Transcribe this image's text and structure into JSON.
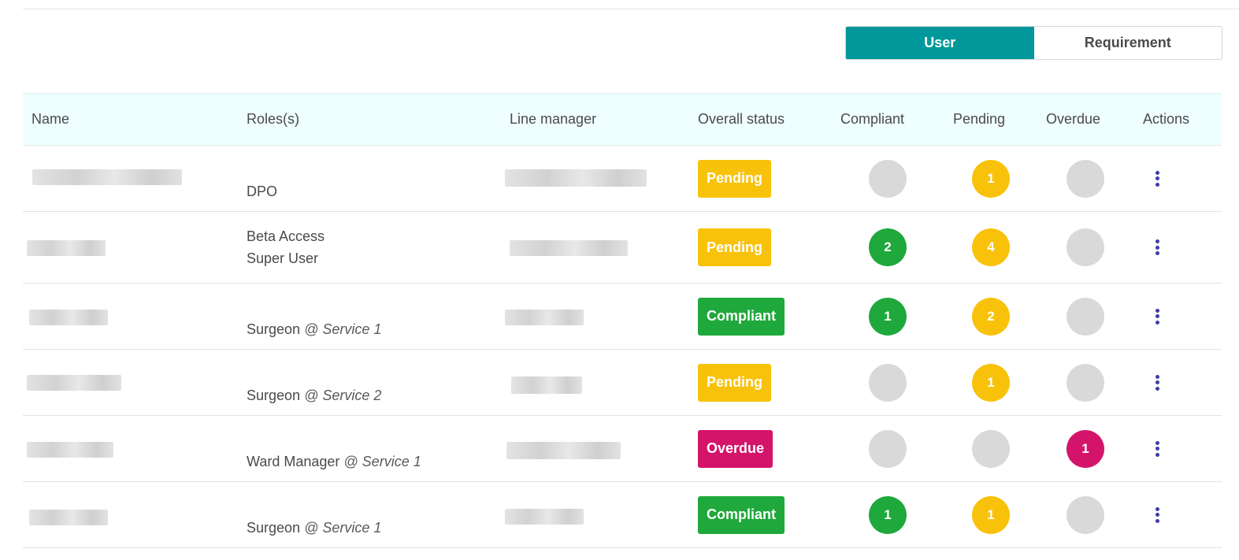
{
  "toggle": {
    "user_label": "User",
    "requirement_label": "Requirement",
    "active": "user"
  },
  "table": {
    "columns": [
      "Name",
      "Roles(s)",
      "Line manager",
      "Overall status",
      "Compliant",
      "Pending",
      "Overdue",
      "Actions"
    ],
    "rows": [
      {
        "name": "",
        "roles": [
          {
            "role": "DPO",
            "service": ""
          }
        ],
        "line_manager": "",
        "status": "Pending",
        "compliant": "",
        "pending": "1",
        "overdue": ""
      },
      {
        "name": "",
        "roles": [
          {
            "role": "Beta Access",
            "service": ""
          },
          {
            "role": "Super User",
            "service": ""
          }
        ],
        "line_manager": "",
        "status": "Pending",
        "compliant": "2",
        "pending": "4",
        "overdue": ""
      },
      {
        "name": "",
        "roles": [
          {
            "role": "Surgeon",
            "service": "@ Service 1"
          }
        ],
        "line_manager": "",
        "status": "Compliant",
        "compliant": "1",
        "pending": "2",
        "overdue": ""
      },
      {
        "name": "",
        "roles": [
          {
            "role": "Surgeon",
            "service": "@ Service 2"
          }
        ],
        "line_manager": "",
        "status": "Pending",
        "compliant": "",
        "pending": "1",
        "overdue": ""
      },
      {
        "name": "",
        "roles": [
          {
            "role": "Ward Manager",
            "service": "@ Service 1"
          }
        ],
        "line_manager": "",
        "status": "Overdue",
        "compliant": "",
        "pending": "",
        "overdue": "1"
      },
      {
        "name": "",
        "roles": [
          {
            "role": "Surgeon",
            "service": "@ Service 1"
          }
        ],
        "line_manager": "",
        "status": "Compliant",
        "compliant": "1",
        "pending": "1",
        "overdue": ""
      }
    ]
  },
  "icons": {
    "row_actions": "kebab-vertical-icon"
  },
  "colors": {
    "accent": "#00989a",
    "header_bg": "#effefe",
    "pending": "#f9c20a",
    "compliant": "#1fa83b",
    "overdue": "#d4146b",
    "empty_circle": "#d9d9d9",
    "actions": "#3c3ca8"
  }
}
